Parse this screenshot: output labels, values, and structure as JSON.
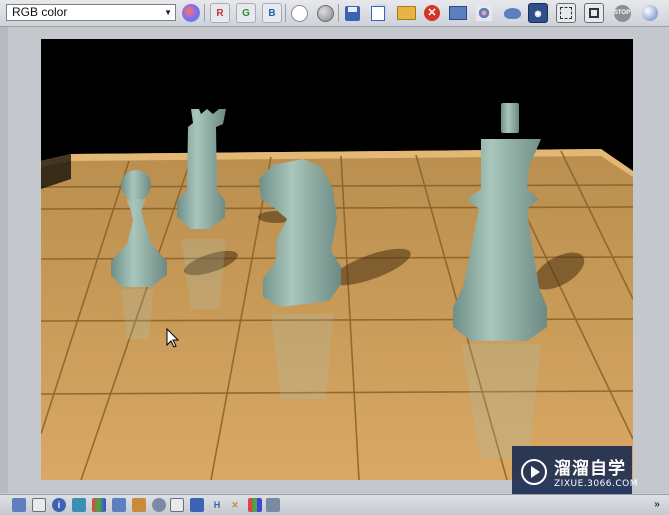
{
  "toolbar": {
    "channel_select": {
      "value": "RGB color"
    },
    "buttons": [
      {
        "name": "rgb-color-wheel-button",
        "icon": "color-wheel-icon"
      },
      {
        "name": "red-channel-button",
        "label": "R",
        "color": "#c0392b"
      },
      {
        "name": "green-channel-button",
        "label": "G",
        "color": "#2e8b3e"
      },
      {
        "name": "blue-channel-button",
        "label": "B",
        "color": "#2f5fb3"
      },
      {
        "name": "white-display-button",
        "icon": "white-circle-icon"
      },
      {
        "name": "mono-display-button",
        "icon": "gray-circle-icon"
      },
      {
        "name": "save-image-button",
        "icon": "floppy-disk-icon"
      },
      {
        "name": "copy-image-button",
        "icon": "copy-icon"
      },
      {
        "name": "open-folder-button",
        "icon": "folder-icon"
      },
      {
        "name": "clear-button",
        "icon": "clear-red-x-icon"
      },
      {
        "name": "print-button",
        "icon": "print-icon"
      },
      {
        "name": "region-button",
        "icon": "region-icon"
      },
      {
        "name": "render-button",
        "icon": "teapot-icon"
      },
      {
        "name": "frame-buffer-button",
        "icon": "frame-buffer-icon"
      },
      {
        "name": "track-region-button",
        "icon": "region-select-icon"
      },
      {
        "name": "history-button",
        "icon": "history-icon"
      },
      {
        "name": "stop-button",
        "icon": "stop-icon",
        "label": "STOP"
      },
      {
        "name": "help-button",
        "icon": "help-icon"
      }
    ]
  },
  "watermark": {
    "title": "溜溜自学",
    "subtitle": "ZIXUE.3066.COM"
  },
  "bottombar": {
    "icons": [
      "window-icon",
      "list-icon",
      "info-icon",
      "tools-icon",
      "palette-icon",
      "chart-icon",
      "brush-icon",
      "settings-icon",
      "compare-icon",
      "pixel-icon",
      "text-h-icon",
      "split-icon",
      "channel-bars-icon",
      "layers-icon"
    ],
    "scroll_icon": "double-chevron-down-icon"
  },
  "colors": {
    "board": "#c99a55",
    "board_dark": "#9c6f34",
    "piece": "#8fb0a6",
    "background": "#000000"
  }
}
